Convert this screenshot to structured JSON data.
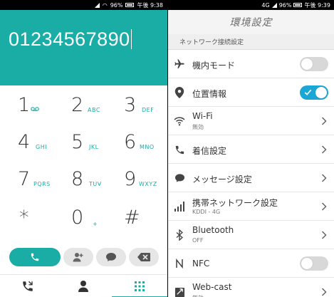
{
  "left_status": {
    "battery": "96%",
    "time": "午後 9:38"
  },
  "dialer": {
    "number": "01234567890",
    "keys": [
      {
        "digit": "1",
        "letters": ""
      },
      {
        "digit": "2",
        "letters": "ABC"
      },
      {
        "digit": "3",
        "letters": "DEF"
      },
      {
        "digit": "4",
        "letters": "GHI"
      },
      {
        "digit": "5",
        "letters": "JKL"
      },
      {
        "digit": "6",
        "letters": "MNO"
      },
      {
        "digit": "7",
        "letters": "PQRS"
      },
      {
        "digit": "8",
        "letters": "TUV"
      },
      {
        "digit": "9",
        "letters": "WXYZ"
      },
      {
        "digit": "*",
        "letters": ""
      },
      {
        "digit": "0",
        "letters": "+"
      },
      {
        "digit": "#",
        "letters": ""
      }
    ],
    "accent_color": "#1aada6"
  },
  "right_status": {
    "network": "4G",
    "battery": "96%",
    "time": "午後 9:39"
  },
  "settings": {
    "title": "環境設定",
    "section": "ネットワーク接続設定",
    "rows": [
      {
        "label": "機内モード",
        "sub": "",
        "icon": "airplane-icon",
        "control": "toggle",
        "on": false
      },
      {
        "label": "位置情報",
        "sub": "",
        "icon": "location-pin-icon",
        "control": "toggle",
        "on": true
      },
      {
        "label": "Wi-Fi",
        "sub": "無効",
        "icon": "wifi-icon",
        "control": "chevron"
      },
      {
        "label": "着信設定",
        "sub": "",
        "icon": "phone-icon",
        "control": "chevron"
      },
      {
        "label": "メッセージ設定",
        "sub": "",
        "icon": "message-bubble-icon",
        "control": "chevron"
      },
      {
        "label": "携帯ネットワーク設定",
        "sub": "KDDI - 4G",
        "icon": "signal-bars-icon",
        "control": "chevron"
      },
      {
        "label": "Bluetooth",
        "sub": "OFF",
        "icon": "bluetooth-icon",
        "control": "chevron"
      },
      {
        "label": "NFC",
        "sub": "",
        "icon": "nfc-icon",
        "control": "toggle",
        "on": false
      },
      {
        "label": "Web-cast",
        "sub": "無効",
        "icon": "webcast-icon",
        "control": "chevron"
      }
    ],
    "toggle_on_color": "#1aa7d6"
  }
}
